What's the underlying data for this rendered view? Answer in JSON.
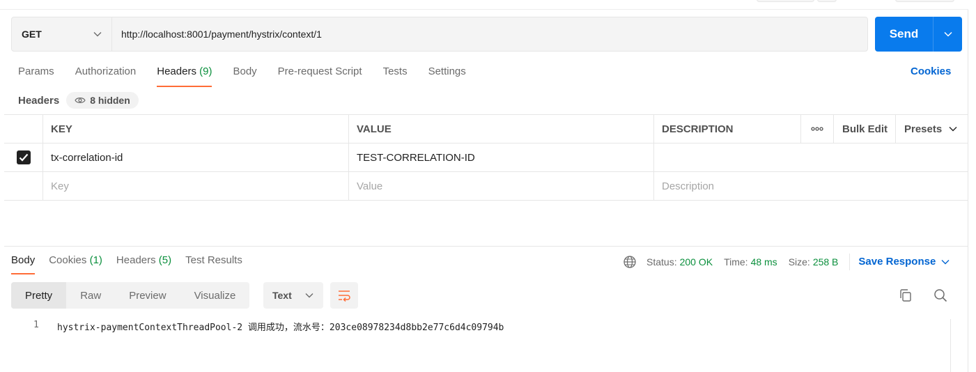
{
  "request": {
    "method": "GET",
    "url": "http://localhost:8001/payment/hystrix/context/1",
    "send_label": "Send"
  },
  "request_tabs": [
    {
      "label": "Params",
      "count": ""
    },
    {
      "label": "Authorization",
      "count": ""
    },
    {
      "label": "Headers",
      "count": "(9)"
    },
    {
      "label": "Body",
      "count": ""
    },
    {
      "label": "Pre-request Script",
      "count": ""
    },
    {
      "label": "Tests",
      "count": ""
    },
    {
      "label": "Settings",
      "count": ""
    }
  ],
  "active_request_tab": "Headers",
  "cookies_link": "Cookies",
  "headers_section": {
    "title": "Headers",
    "hidden_label": "8 hidden"
  },
  "headers_table": {
    "columns": {
      "key": "KEY",
      "value": "VALUE",
      "description": "DESCRIPTION"
    },
    "bulk_edit": "Bulk Edit",
    "presets": "Presets",
    "rows": [
      {
        "checked": true,
        "key": "tx-correlation-id",
        "value": "TEST-CORRELATION-ID",
        "description": ""
      }
    ],
    "placeholders": {
      "key": "Key",
      "value": "Value",
      "description": "Description"
    }
  },
  "response_tabs": [
    {
      "label": "Body",
      "count": ""
    },
    {
      "label": "Cookies",
      "count": "(1)"
    },
    {
      "label": "Headers",
      "count": "(5)"
    },
    {
      "label": "Test Results",
      "count": ""
    }
  ],
  "response_meta": {
    "status_label": "Status:",
    "status_value": "200 OK",
    "time_label": "Time:",
    "time_value": "48 ms",
    "size_label": "Size:",
    "size_value": "258 B",
    "save_response": "Save Response"
  },
  "format_options": [
    "Pretty",
    "Raw",
    "Preview",
    "Visualize"
  ],
  "active_format": "Pretty",
  "language": "Text",
  "response_body": {
    "line_number": "1",
    "text": "hystrix-paymentContextThreadPool-2 调用成功，流水号：203ce08978234d8bb2e77c6d4c09794b"
  },
  "colors": {
    "accent": "#ff6c37",
    "send": "#097bed",
    "link": "#0265d2",
    "success": "#0a8f3c"
  }
}
